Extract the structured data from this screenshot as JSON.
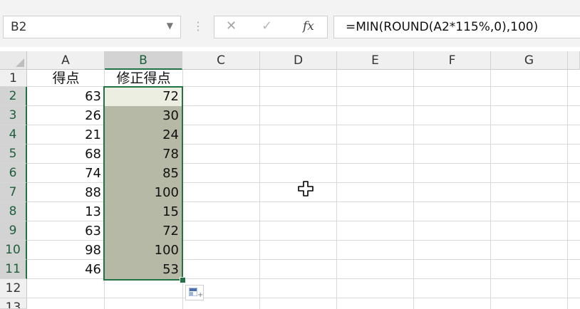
{
  "formula_bar": {
    "name_box": "B2",
    "separator": "⋮",
    "cancel_glyph": "✕",
    "enter_glyph": "✓",
    "fx_glyph": "fx",
    "formula": "=MIN(ROUND(A2*115%,0),100)"
  },
  "columns": [
    "A",
    "B",
    "C",
    "D",
    "E",
    "F",
    "G"
  ],
  "rows": [
    "1",
    "2",
    "3",
    "4",
    "5",
    "6",
    "7",
    "8",
    "9",
    "10",
    "11",
    "12",
    "13"
  ],
  "sheet": {
    "A1": "得点",
    "B1": "修正得点",
    "score": [
      "63",
      "26",
      "21",
      "68",
      "74",
      "88",
      "13",
      "63",
      "98",
      "46"
    ],
    "adjusted": [
      "72",
      "30",
      "24",
      "78",
      "85",
      "100",
      "15",
      "72",
      "100",
      "53"
    ]
  },
  "selection": {
    "active_cell": "B2",
    "range": "B2:B11",
    "accent_color": "#217346",
    "fill_color": "#b5b9a6"
  },
  "icons": {
    "quick_analysis": "quick-analysis-icon",
    "cursor": "cross-cursor-icon"
  }
}
